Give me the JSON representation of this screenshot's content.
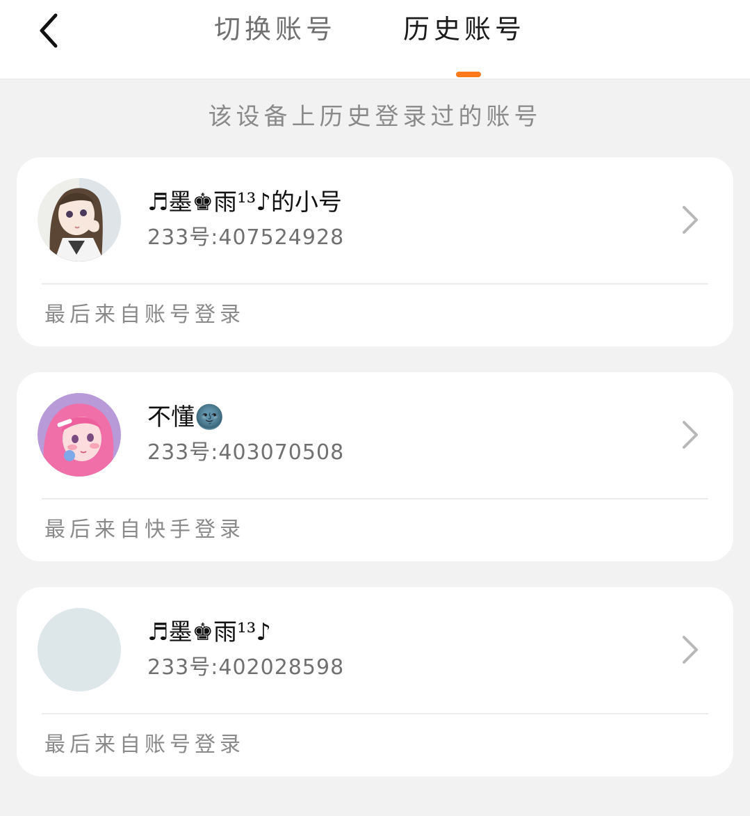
{
  "header": {
    "tabs": [
      {
        "label": "切换账号",
        "active": false
      },
      {
        "label": "历史账号",
        "active": true
      }
    ],
    "accent_color": "#ff7a1a",
    "back_icon": "chevron-left-icon"
  },
  "subtitle": "该设备上历史登录过的账号",
  "accounts": [
    {
      "name": "♬墨♚雨¹³♪的小号",
      "id_line": "233号:407524928",
      "source": "最后来自账号登录",
      "avatar": "anime-girl-brown-hair"
    },
    {
      "name": "不懂🌚",
      "id_line": "233号:403070508",
      "source": "最后来自快手登录",
      "avatar": "anime-girl-pink-hair"
    },
    {
      "name": "♬墨♚雨¹³♪",
      "id_line": "233号:402028598",
      "source": "最后来自账号登录",
      "avatar": "blank-avatar"
    }
  ]
}
